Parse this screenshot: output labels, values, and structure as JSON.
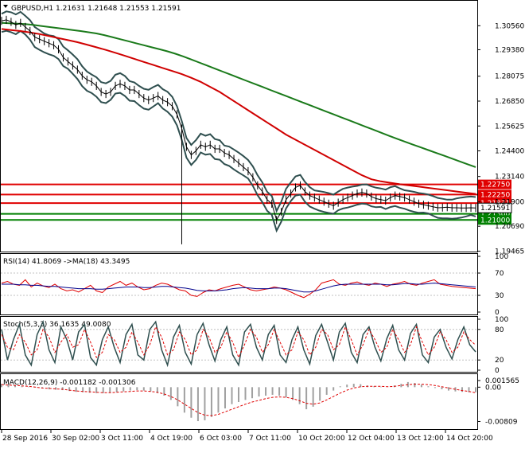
{
  "chart_data": [
    {
      "type": "line",
      "pane": "price",
      "title": "GBPUSD,H1  1.21631 1.21648 1.21553 1.21591",
      "ylim": [
        1.196,
        1.312
      ],
      "y_ticks": [
        "1.30560",
        "1.29380",
        "1.28075",
        "1.26850",
        "1.25625",
        "1.24400",
        "1.23140",
        "1.21900",
        "1.20690",
        "1.19465"
      ],
      "x_range": [
        0,
        100
      ],
      "series": [],
      "close_x": [
        0,
        1,
        2,
        3,
        4,
        5,
        6,
        7,
        8,
        9,
        10,
        11,
        12,
        13,
        14,
        15,
        16,
        17,
        18,
        19,
        20,
        21,
        22,
        23,
        24,
        25,
        26,
        27,
        28,
        29,
        30,
        31,
        32,
        33,
        34,
        35,
        36,
        37,
        38,
        39,
        40,
        41,
        42,
        43,
        44,
        45,
        46,
        47,
        48,
        49,
        50,
        51,
        52,
        53,
        54,
        55,
        56,
        57,
        58,
        59,
        60,
        61,
        62,
        63,
        64,
        65,
        66,
        67,
        68,
        69,
        70,
        71,
        72,
        73,
        74,
        75,
        76,
        77,
        78,
        79,
        80,
        81,
        82,
        83,
        84,
        85,
        86,
        87,
        88,
        89,
        90,
        91,
        92,
        93,
        94,
        95,
        96,
        97,
        98,
        99,
        100
      ],
      "close": [
        1.308,
        1.3085,
        1.3075,
        1.306,
        1.307,
        1.305,
        1.303,
        1.3,
        1.299,
        1.298,
        1.297,
        1.296,
        1.294,
        1.29,
        1.288,
        1.286,
        1.284,
        1.281,
        1.279,
        1.278,
        1.276,
        1.273,
        1.272,
        1.273,
        1.276,
        1.277,
        1.276,
        1.274,
        1.274,
        1.272,
        1.27,
        1.269,
        1.27,
        1.271,
        1.269,
        1.268,
        1.266,
        1.262,
        1.255,
        1.246,
        1.242,
        1.244,
        1.247,
        1.246,
        1.247,
        1.245,
        1.245,
        1.243,
        1.242,
        1.24,
        1.238,
        1.236,
        1.234,
        1.231,
        1.227,
        1.224,
        1.22,
        1.218,
        1.21,
        1.214,
        1.22,
        1.223,
        1.226,
        1.227,
        1.224,
        1.222,
        1.221,
        1.22,
        1.219,
        1.218,
        1.217,
        1.2185,
        1.22,
        1.221,
        1.222,
        1.223,
        1.2235,
        1.223,
        1.2215,
        1.2205,
        1.22,
        1.2195,
        1.221,
        1.222,
        1.2215,
        1.221,
        1.22,
        1.219,
        1.218,
        1.2175,
        1.217,
        1.2165,
        1.216,
        1.2161,
        1.2163,
        1.216,
        1.216,
        1.2159,
        1.2159,
        1.216,
        1.2159
      ],
      "ma_green": [
        1.307,
        1.3068,
        1.3066,
        1.3064,
        1.306,
        1.3055,
        1.305,
        1.3045,
        1.304,
        1.3035,
        1.303,
        1.3024,
        1.3018,
        1.301,
        1.3,
        1.299,
        1.298,
        1.297,
        1.296,
        1.295,
        1.294,
        1.293,
        1.2918,
        1.2905,
        1.289,
        1.2875,
        1.286,
        1.2845,
        1.283,
        1.2815,
        1.28,
        1.2785,
        1.277,
        1.2755,
        1.274,
        1.2725,
        1.271,
        1.2695,
        1.268,
        1.2665,
        1.265,
        1.2635,
        1.262,
        1.2605,
        1.259,
        1.2575,
        1.256,
        1.2545,
        1.253,
        1.2515,
        1.25,
        1.2486,
        1.2472,
        1.2458,
        1.2444,
        1.243,
        1.2416,
        1.2402,
        1.2388,
        1.2374,
        1.236
      ],
      "ma_red": [
        1.304,
        1.3035,
        1.303,
        1.3023,
        1.3015,
        1.3005,
        1.2995,
        1.2985,
        1.2975,
        1.2963,
        1.295,
        1.2937,
        1.2923,
        1.2908,
        1.2893,
        1.2878,
        1.2863,
        1.2848,
        1.2833,
        1.2818,
        1.28,
        1.278,
        1.2755,
        1.273,
        1.27,
        1.267,
        1.264,
        1.261,
        1.258,
        1.255,
        1.252,
        1.2495,
        1.247,
        1.2445,
        1.242,
        1.2395,
        1.237,
        1.2345,
        1.232,
        1.23,
        1.229,
        1.2283,
        1.2276,
        1.227,
        1.2264,
        1.2258,
        1.2252,
        1.2246,
        1.224,
        1.2234,
        1.2228
      ],
      "hlines": [
        {
          "value": 1.2275,
          "label": "1.22750",
          "color": "#e00000"
        },
        {
          "value": 1.2225,
          "label": "1.22250",
          "color": "#e00000"
        },
        {
          "value": 1.21831,
          "label": "1.21831",
          "color": "#e00000"
        },
        {
          "value": 1.213,
          "label": "1.21300",
          "color": "#008000"
        },
        {
          "value": 1.21,
          "label": "1.21000",
          "color": "#008000"
        }
      ],
      "current_price": {
        "value": 1.21591,
        "label": "1.21591",
        "color": "#000000"
      },
      "x_ticks": [
        "28 Sep 2016",
        "30 Sep 02:00",
        "3 Oct 11:00",
        "4 Oct 19:00",
        "6 Oct 03:00",
        "7 Oct 11:00",
        "10 Oct 20:00",
        "12 Oct 04:00",
        "13 Oct 12:00",
        "14 Oct 20:00"
      ]
    },
    {
      "type": "line",
      "pane": "rsi",
      "title": "RSI(14) 41.8069  ->MA(18) 43.3495",
      "ylim": [
        0,
        100
      ],
      "y_ticks": [
        "100",
        "70",
        "30",
        "0"
      ],
      "levels": [
        70,
        30
      ],
      "series": [],
      "rsi": [
        52,
        55,
        50,
        48,
        58,
        45,
        52,
        47,
        44,
        50,
        42,
        38,
        40,
        36,
        42,
        48,
        38,
        35,
        45,
        50,
        55,
        48,
        52,
        45,
        40,
        42,
        48,
        52,
        50,
        45,
        40,
        38,
        30,
        28,
        35,
        40,
        38,
        42,
        45,
        48,
        50,
        45,
        40,
        38,
        40,
        42,
        45,
        43,
        40,
        35,
        30,
        26,
        32,
        40,
        52,
        55,
        58,
        50,
        48,
        52,
        54,
        50,
        48,
        52,
        50,
        46,
        50,
        52,
        55,
        50,
        48,
        52,
        55,
        58,
        50,
        48,
        46,
        45,
        44,
        43,
        42
      ],
      "rsi_ma": [
        50,
        50,
        50,
        49,
        49,
        48,
        48,
        47,
        46,
        46,
        45,
        44,
        43,
        42,
        42,
        42,
        41,
        41,
        42,
        43,
        44,
        45,
        45,
        45,
        44,
        44,
        45,
        46,
        46,
        45,
        44,
        43,
        41,
        39,
        38,
        38,
        38,
        39,
        40,
        42,
        43,
        44,
        43,
        42,
        42,
        42,
        43,
        43,
        42,
        40,
        38,
        36,
        36,
        38,
        41,
        44,
        47,
        49,
        50,
        50,
        50,
        50,
        50,
        50,
        50,
        49,
        49,
        50,
        51,
        51,
        50,
        50,
        51,
        52,
        51,
        50,
        49,
        48,
        47,
        46,
        45
      ]
    },
    {
      "type": "line",
      "pane": "stochastic",
      "title": "Stoch(5,3,3) 36.1635 49.0080",
      "ylim": [
        0,
        100
      ],
      "y_ticks": [
        "100",
        "80",
        "20",
        "0"
      ],
      "levels": [
        80,
        20
      ],
      "series": [],
      "main": [
        80,
        20,
        60,
        90,
        30,
        10,
        70,
        95,
        40,
        15,
        85,
        60,
        20,
        75,
        90,
        25,
        10,
        60,
        85,
        45,
        15,
        70,
        90,
        30,
        20,
        80,
        95,
        40,
        10,
        65,
        88,
        35,
        12,
        70,
        92,
        50,
        18,
        60,
        85,
        30,
        10,
        75,
        90,
        45,
        20,
        70,
        88,
        30,
        15,
        60,
        85,
        40,
        12,
        68,
        90,
        55,
        20,
        75,
        92,
        35,
        15,
        70,
        85,
        45,
        18,
        62,
        88,
        40,
        20,
        72,
        90,
        30,
        15,
        65,
        80,
        45,
        22,
        60,
        85,
        50,
        36
      ],
      "signal": [
        70,
        45,
        40,
        70,
        55,
        30,
        40,
        80,
        65,
        35,
        55,
        70,
        45,
        50,
        80,
        55,
        25,
        35,
        70,
        60,
        35,
        45,
        75,
        55,
        30,
        50,
        85,
        65,
        30,
        40,
        75,
        60,
        30,
        40,
        80,
        65,
        35,
        45,
        75,
        55,
        25,
        50,
        80,
        65,
        35,
        50,
        80,
        55,
        30,
        40,
        75,
        60,
        30,
        45,
        80,
        70,
        40,
        50,
        85,
        60,
        30,
        50,
        80,
        60,
        35,
        45,
        80,
        60,
        35,
        50,
        85,
        55,
        30,
        45,
        75,
        60,
        35,
        45,
        75,
        60,
        49
      ]
    },
    {
      "type": "bar",
      "pane": "macd",
      "title": "MACD(12,26,9) -0.001182 -0.001306",
      "ylim": [
        -0.0095,
        0.0025
      ],
      "y_ticks": [
        "0.001565",
        "0.00",
        "-0.00809"
      ],
      "series": [],
      "histogram": [
        0.0008,
        0.0006,
        0.0004,
        0.0002,
        0.0001,
        -0.0001,
        -0.0003,
        -0.0005,
        -0.0006,
        -0.0007,
        -0.0009,
        -0.0011,
        -0.0012,
        -0.0013,
        -0.0014,
        -0.0014,
        -0.0013,
        -0.0012,
        -0.001,
        -0.0008,
        -0.0007,
        -0.0008,
        -0.001,
        -0.0014,
        -0.002,
        -0.003,
        -0.0045,
        -0.006,
        -0.0072,
        -0.008,
        -0.0078,
        -0.007,
        -0.006,
        -0.005,
        -0.004,
        -0.0035,
        -0.003,
        -0.0026,
        -0.0022,
        -0.002,
        -0.0018,
        -0.002,
        -0.0024,
        -0.003,
        -0.004,
        -0.0052,
        -0.0046,
        -0.0032,
        -0.0018,
        -0.0008,
        0.0002,
        0.0006,
        0.0008,
        0.0007,
        0.0004,
        0.0002,
        0.0001,
        0.0,
        0.0004,
        0.0008,
        0.0012,
        0.001,
        0.0006,
        0.0002,
        -0.0002,
        -0.0005,
        -0.0008,
        -0.001,
        -0.0011,
        -0.0012,
        -0.0012
      ],
      "signal": [
        0.0006,
        0.0005,
        0.0004,
        0.0003,
        0.0002,
        0.0,
        -0.0002,
        -0.0003,
        -0.0004,
        -0.0005,
        -0.0007,
        -0.0009,
        -0.001,
        -0.0011,
        -0.0012,
        -0.0013,
        -0.0013,
        -0.0012,
        -0.0011,
        -0.001,
        -0.0009,
        -0.0009,
        -0.001,
        -0.0012,
        -0.0016,
        -0.0022,
        -0.003,
        -0.004,
        -0.005,
        -0.006,
        -0.0066,
        -0.0067,
        -0.0064,
        -0.0058,
        -0.0052,
        -0.0046,
        -0.004,
        -0.0035,
        -0.0031,
        -0.0027,
        -0.0024,
        -0.0023,
        -0.0024,
        -0.0027,
        -0.0032,
        -0.0038,
        -0.004,
        -0.0037,
        -0.003,
        -0.0022,
        -0.0014,
        -0.0007,
        -0.0002,
        0.0001,
        0.0002,
        0.0002,
        0.0002,
        0.0001,
        0.0002,
        0.0004,
        0.0006,
        0.0007,
        0.0007,
        0.0006,
        0.0004,
        0.0001,
        -0.0002,
        -0.0005,
        -0.0008,
        -0.001,
        -0.0013
      ]
    }
  ]
}
